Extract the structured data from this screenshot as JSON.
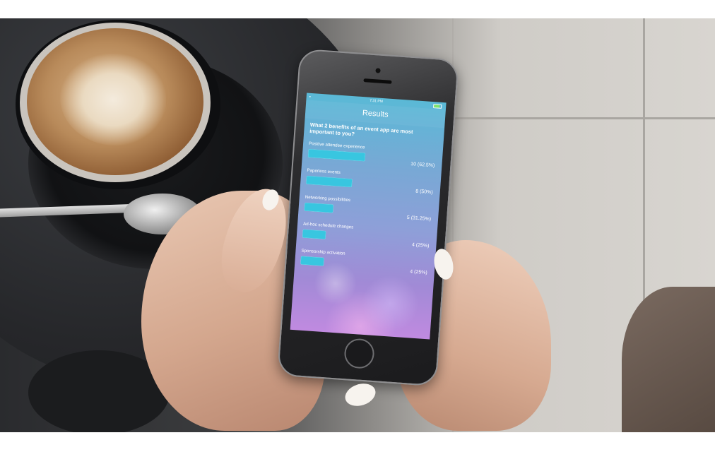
{
  "status_bar": {
    "time": "7:31 PM"
  },
  "nav": {
    "title": "Results"
  },
  "poll": {
    "question": "What 2 benefits of an event app are most important to you?",
    "results": [
      {
        "label": "Positive attendee experience",
        "value": "10 (62.5%)",
        "fraction": 0.625
      },
      {
        "label": "Paperless events",
        "value": "8 (50%)",
        "fraction": 0.5
      },
      {
        "label": "Networking possibilities",
        "value": "5 (31.25%)",
        "fraction": 0.3125
      },
      {
        "label": "Ad-hoc schedule changes",
        "value": "4 (25%)",
        "fraction": 0.25
      },
      {
        "label": "Sponsorship activation",
        "value": "4 (25%)",
        "fraction": 0.25
      }
    ]
  },
  "colors": {
    "bar": "#38c6e0",
    "header": "#5ab9d6",
    "accent_purple": "#a18ad6"
  },
  "icons": [
    "wifi-icon",
    "battery-icon"
  ]
}
